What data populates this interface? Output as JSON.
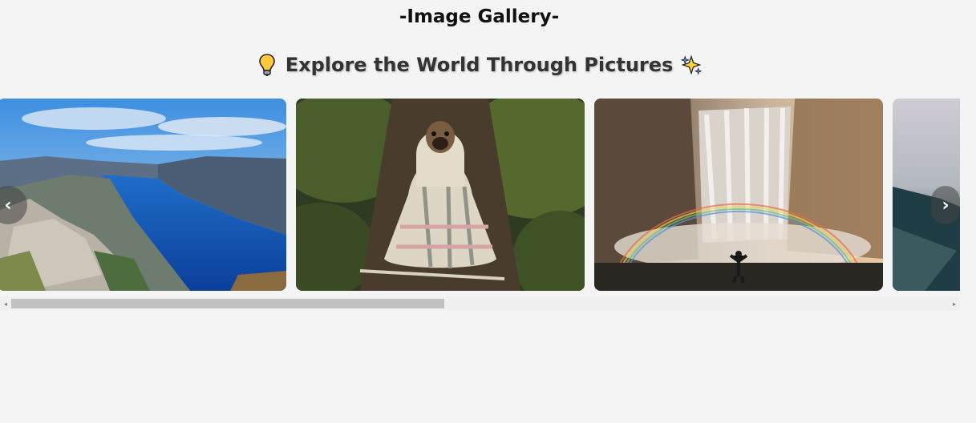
{
  "header": {
    "title": "-Image Gallery-",
    "subtitle": "Explore the World Through Pictures",
    "subtitle_left_icon": "lightbulb-icon",
    "subtitle_right_icon": "sparkles-icon"
  },
  "gallery": {
    "photos": [
      {
        "subject": "fjord-cliff"
      },
      {
        "subject": "pug-in-blanket"
      },
      {
        "subject": "waterfall-rainbow"
      },
      {
        "subject": "misty-mountain"
      }
    ],
    "prev_label": "‹",
    "next_label": "›"
  },
  "scrollbar": {
    "left_arrow": "◂",
    "right_arrow": "▸",
    "position_fraction": 0.0
  },
  "colors": {
    "background": "#f4f4f4",
    "title": "#111111",
    "subtitle": "#333333"
  }
}
